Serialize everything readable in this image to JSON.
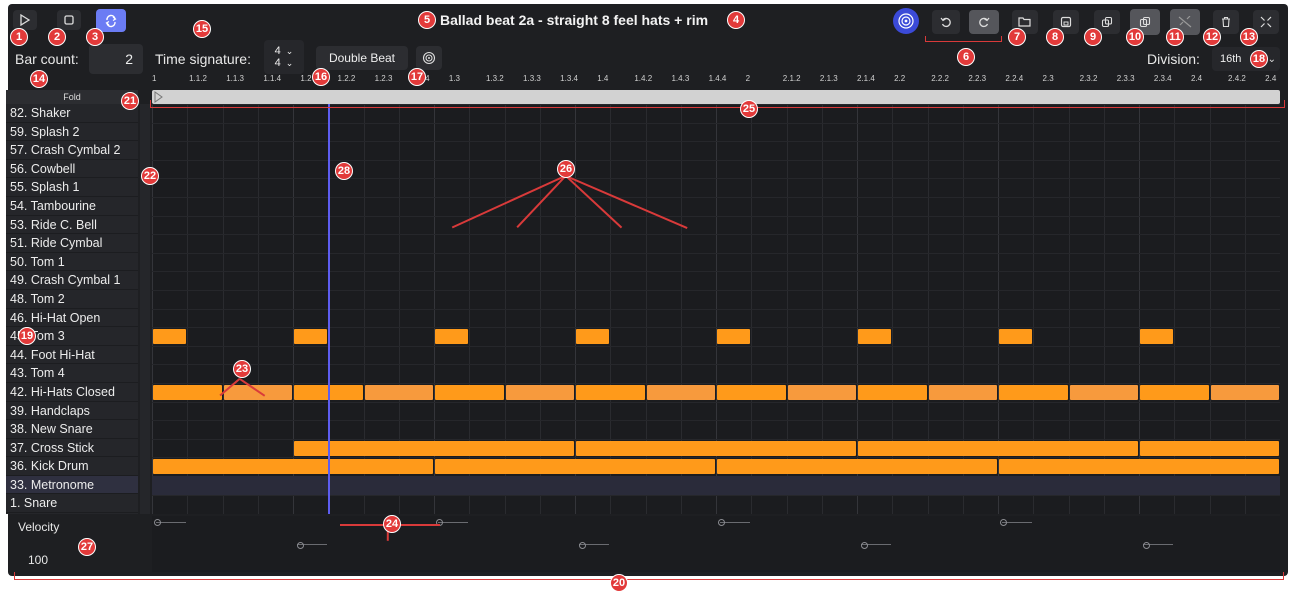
{
  "title": "Ballad beat 2a - straight 8 feel hats + rim",
  "bar_count": {
    "label": "Bar count:",
    "value": "2"
  },
  "time_signature": {
    "label": "Time signature:",
    "top": "4",
    "bottom": "4"
  },
  "double_beat_label": "Double Beat",
  "division": {
    "label": "Division:",
    "value": "16th"
  },
  "fold_label": "Fold",
  "velocity": {
    "label": "Velocity",
    "value": "100"
  },
  "tracks": [
    "82. Shaker",
    "59. Splash 2",
    "57. Crash Cymbal 2",
    "56. Cowbell",
    "55. Splash 1",
    "54. Tambourine",
    "53. Ride C. Bell",
    "51. Ride Cymbal",
    "50. Tom 1",
    "49. Crash Cymbal 1",
    "48. Tom 2",
    "46. Hi-Hat Open",
    "45. Tom 3",
    "44. Foot Hi-Hat",
    "43. Tom 4",
    "42. Hi-Hats Closed",
    "39. Handclaps",
    "38. New Snare",
    "37. Cross Stick",
    "36. Kick Drum",
    "33. Metronome",
    "1. Snare"
  ],
  "ruler_ticks": [
    "1",
    "1.1.2",
    "1.1.3",
    "1.1.4",
    "1.2",
    "1.2.2",
    "1.2.3",
    "1.2.4",
    "1.3",
    "1.3.2",
    "1.3.3",
    "1.3.4",
    "1.4",
    "1.4.2",
    "1.4.3",
    "1.4.4",
    "2",
    "2.1.2",
    "2.1.3",
    "2.1.4",
    "2.2",
    "2.2.2",
    "2.2.3",
    "2.2.4",
    "2.3",
    "2.3.2",
    "2.3.3",
    "2.3.4",
    "2.4",
    "2.4.2",
    "2.4"
  ],
  "icons": {
    "play": "play-icon",
    "stop": "stop-icon",
    "loop": "loop-icon",
    "midi": "midi-signal-icon",
    "undo": "undo-icon",
    "redo": "redo-icon",
    "open": "folder-open-icon",
    "save": "save-icon",
    "duplicate": "duplicate-icon",
    "copy": "copy-icon",
    "unlink": "unlink-icon",
    "delete": "trash-icon",
    "shrink": "collapse-icon",
    "metronome": "metronome-icon",
    "chevron": "chevron-down-icon"
  },
  "badges": [
    "1",
    "2",
    "3",
    "4",
    "5",
    "6",
    "7",
    "8",
    "9",
    "10",
    "11",
    "12",
    "13",
    "14",
    "15",
    "16",
    "17",
    "18",
    "19",
    "20",
    "21",
    "22",
    "23",
    "24",
    "25",
    "26",
    "27",
    "28"
  ],
  "colors": {
    "note": "#ff9a1a",
    "accent": "#4b5bd6",
    "annotation": "#e23a3a",
    "playhead": "#5d5df0"
  },
  "pattern": {
    "steps_total": 32,
    "tom3_steps": [
      0,
      4,
      8,
      12,
      16,
      20,
      24,
      28
    ],
    "hihat_closed": "every 2 steps across both bars",
    "cross_stick_segments": [
      [
        4,
        12
      ],
      [
        12,
        20
      ],
      [
        20,
        28
      ],
      [
        28,
        32
      ]
    ],
    "kick_segments": [
      [
        0,
        8
      ],
      [
        8,
        16
      ],
      [
        16,
        24
      ],
      [
        24,
        32
      ]
    ],
    "playhead_step": 5
  }
}
